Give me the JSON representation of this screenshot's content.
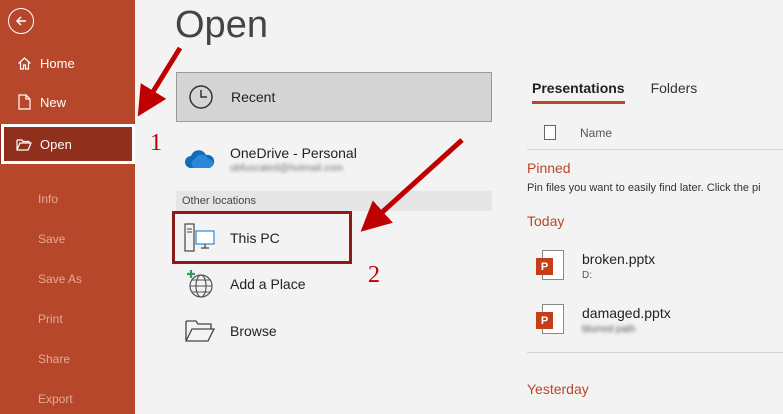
{
  "page_title": "Open",
  "nav": {
    "home": "Home",
    "new": "New",
    "open": "Open",
    "info": "Info",
    "save": "Save",
    "save_as": "Save As",
    "print": "Print",
    "share": "Share",
    "export": "Export"
  },
  "locations": {
    "recent": "Recent",
    "onedrive": "OneDrive - Personal",
    "onedrive_sub": "obfuscated@hotmail.com",
    "other_locations": "Other locations",
    "this_pc": "This PC",
    "add_place": "Add a Place",
    "browse": "Browse"
  },
  "tabs": {
    "presentations": "Presentations",
    "folders": "Folders"
  },
  "list": {
    "name_header": "Name",
    "pinned_heading": "Pinned",
    "pinned_text": "Pin files you want to easily find later. Click the pi",
    "today_heading": "Today",
    "yesterday_heading": "Yesterday",
    "files": [
      {
        "name": "broken.pptx",
        "path": "D:"
      },
      {
        "name": "damaged.pptx",
        "path": "blurred path"
      }
    ]
  },
  "annotations": {
    "step1": "1",
    "step2": "2"
  },
  "colors": {
    "sidebar": "#b7472a",
    "selected_nav": "#8f2f1c",
    "annotation_red": "#c00000",
    "highlight_box": "#8b1a1a"
  }
}
